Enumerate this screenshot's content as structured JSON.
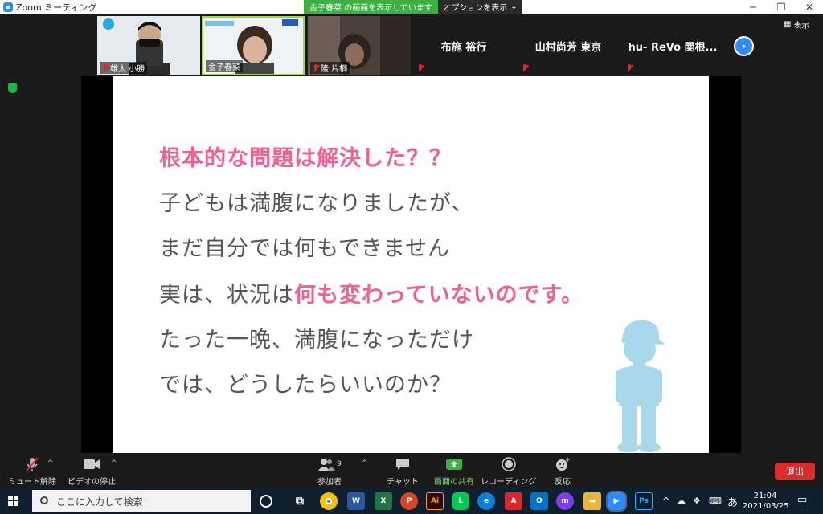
{
  "window": {
    "title": "Zoom ミーティング",
    "share_banner": "金子春菜 の画面を表示しています",
    "options_label": "オプションを表示"
  },
  "gallery": {
    "participants": [
      {
        "name": "雄太 小勝",
        "muted": true
      },
      {
        "name": "金子春菜",
        "muted": false
      },
      {
        "name": "隆 片桐",
        "muted": true
      },
      {
        "name": "布施 裕行",
        "muted": true
      },
      {
        "name": "山村尚芳 東京",
        "muted": true
      },
      {
        "name": "hu- ReVo 関根...",
        "muted": true
      }
    ],
    "view_label": "表示"
  },
  "slide": {
    "line1": "根本的な問題は解決した？？",
    "line2": "子どもは満腹になりましたが、",
    "line3": "まだ自分では何もできません",
    "line4_plain": "実は、状況は",
    "line4_pink": "何も変わっていないのです。",
    "line5": "たった一晩、満腹になっただけ",
    "line6": "では、どうしたらいいのか？"
  },
  "toolbar": {
    "unmute": "ミュート解除",
    "stop_video": "ビデオの停止",
    "participants": "参加者",
    "participant_count": "9",
    "chat": "チャット",
    "share_screen": "画面の共有",
    "record": "レコーディング",
    "reactions": "反応",
    "leave": "退出"
  },
  "taskbar": {
    "search_placeholder": "ここに入力して検索",
    "ime": "あ",
    "time": "21:04",
    "date": "2021/03/25"
  },
  "colors": {
    "accent_blue": "#2d8cff",
    "share_green": "#3cb043",
    "leave_red": "#d92d2d",
    "slide_pink": "#f06090"
  }
}
